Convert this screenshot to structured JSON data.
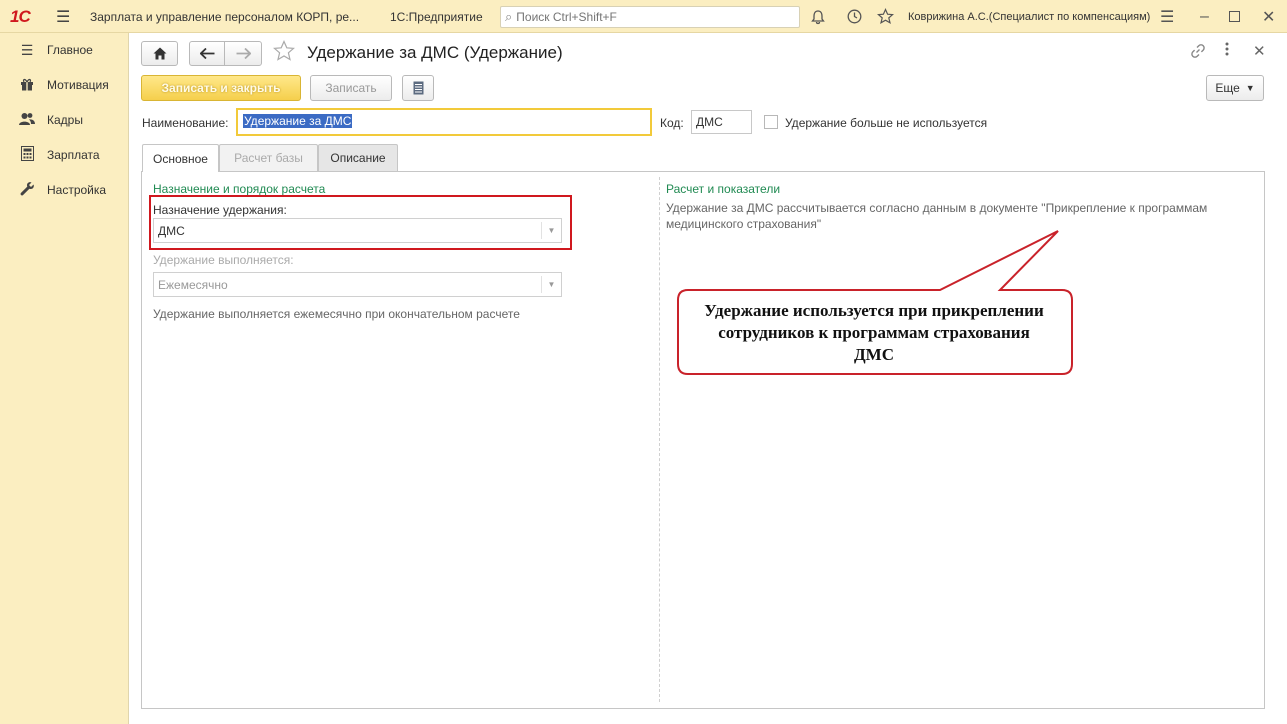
{
  "titlebar": {
    "logo": "1С",
    "app_title": "Зарплата и управление персоналом КОРП, ре...",
    "platform": "1С:Предприятие",
    "search_placeholder": "Поиск Ctrl+Shift+F",
    "user": "Коврижина А.С.(Специалист по компенсациям)"
  },
  "sidebar": {
    "items": [
      {
        "label": "Главное",
        "icon": "menu-icon"
      },
      {
        "label": "Мотивация",
        "icon": "gift-icon"
      },
      {
        "label": "Кадры",
        "icon": "people-icon"
      },
      {
        "label": "Зарплата",
        "icon": "calculator-icon"
      },
      {
        "label": "Настройка",
        "icon": "wrench-icon"
      }
    ]
  },
  "form": {
    "title": "Удержание за ДМС (Удержание)",
    "toolbar": {
      "save_close": "Записать и закрыть",
      "save": "Записать",
      "more": "Еще"
    },
    "name_label": "Наименование:",
    "name_value": "Удержание за ДМС",
    "code_label": "Код:",
    "code_value": "ДМС",
    "unused_label": "Удержание больше не используется",
    "tabs": [
      {
        "label": "Основное"
      },
      {
        "label": "Расчет базы"
      },
      {
        "label": "Описание"
      }
    ],
    "left": {
      "section_title": "Назначение и порядок расчета",
      "purpose_label": "Назначение удержания:",
      "purpose_value": "ДМС",
      "run_label": "Удержание выполняется:",
      "run_value": "Ежемесячно",
      "run_description": "Удержание выполняется ежемесячно при окончательном расчете"
    },
    "right": {
      "section_title": "Расчет и показатели",
      "description": "Удержание за ДМС рассчитывается согласно данным в документе \"Прикрепление к программам медицинского страхования\""
    }
  },
  "callout": {
    "text": "Удержание используется при прикреплении сотрудников к программам страхования ДМС"
  },
  "colors": {
    "accent_yellow": "#f5cf4c",
    "section_green": "#208a52",
    "highlight_red": "#d0181e"
  }
}
